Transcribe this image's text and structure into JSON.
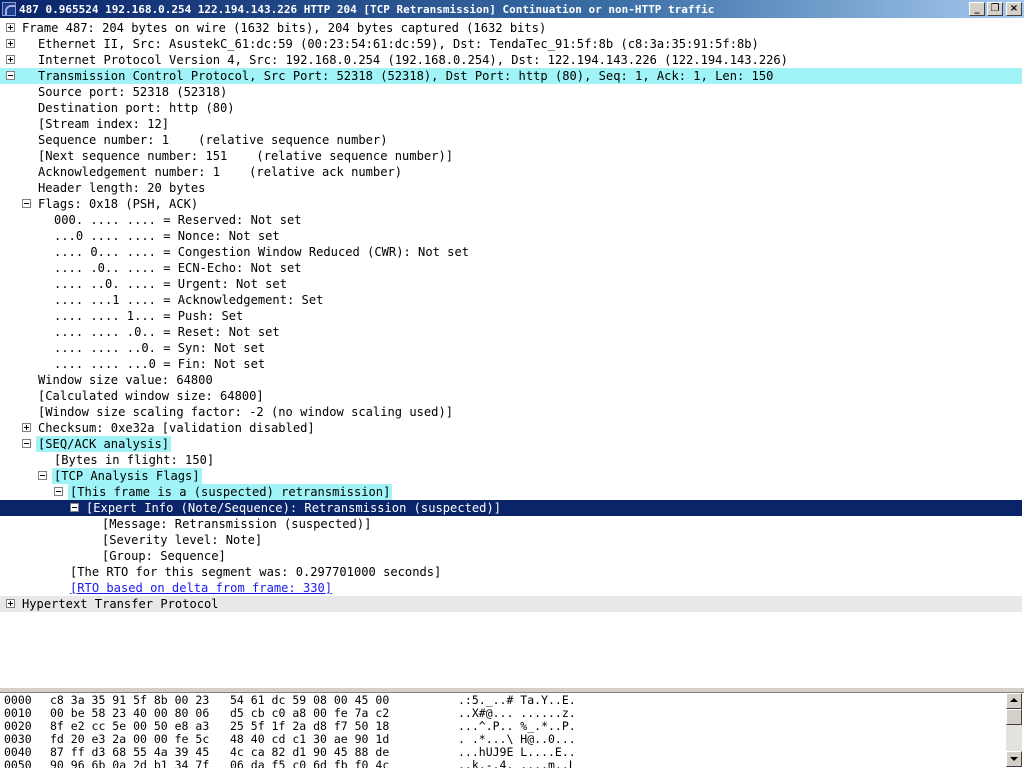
{
  "window": {
    "title": "487 0.965524 192.168.0.254 122.194.143.226 HTTP 204 [TCP Retransmission] Continuation or non-HTTP traffic",
    "minimize": "_",
    "restore": "❐",
    "close": "×"
  },
  "tree": [
    {
      "text": "Frame 487: 204 bytes on wire (1632 bits), 204 bytes captured (1632 bits)",
      "toggle": "plus"
    },
    {
      "text": "Ethernet II, Src: AsustekC_61:dc:59 (00:23:54:61:dc:59), Dst: TendaTec_91:5f:8b (c8:3a:35:91:5f:8b)",
      "toggle": "plus"
    },
    {
      "text": "Internet Protocol Version 4, Src: 192.168.0.254 (192.168.0.254), Dst: 122.194.143.226 (122.194.143.226)",
      "toggle": "plus"
    },
    {
      "text": "Transmission Control Protocol, Src Port: 52318 (52318), Dst Port: http (80), Seq: 1, Ack: 1, Len: 150",
      "toggle": "minus"
    },
    {
      "text": "Source port: 52318 (52318)"
    },
    {
      "text": "Destination port: http (80)"
    },
    {
      "text": "[Stream index: 12]"
    },
    {
      "text": "Sequence number: 1    (relative sequence number)"
    },
    {
      "text": "[Next sequence number: 151    (relative sequence number)]"
    },
    {
      "text": "Acknowledgement number: 1    (relative ack number)"
    },
    {
      "text": "Header length: 20 bytes"
    },
    {
      "text": "Flags: 0x18 (PSH, ACK)",
      "toggle": "minus"
    },
    {
      "text": "000. .... .... = Reserved: Not set"
    },
    {
      "text": "...0 .... .... = Nonce: Not set"
    },
    {
      "text": ".... 0... .... = Congestion Window Reduced (CWR): Not set"
    },
    {
      "text": ".... .0.. .... = ECN-Echo: Not set"
    },
    {
      "text": ".... ..0. .... = Urgent: Not set"
    },
    {
      "text": ".... ...1 .... = Acknowledgement: Set"
    },
    {
      "text": ".... .... 1... = Push: Set"
    },
    {
      "text": ".... .... .0.. = Reset: Not set"
    },
    {
      "text": ".... .... ..0. = Syn: Not set"
    },
    {
      "text": ".... .... ...0 = Fin: Not set"
    },
    {
      "text": "Window size value: 64800"
    },
    {
      "text": "[Calculated window size: 64800]"
    },
    {
      "text": "[Window size scaling factor: -2 (no window scaling used)]"
    },
    {
      "text": "Checksum: 0xe32a [validation disabled]",
      "toggle": "plus"
    },
    {
      "text": "[SEQ/ACK analysis]",
      "toggle": "minus"
    },
    {
      "text": "[Bytes in flight: 150]"
    },
    {
      "text": "[TCP Analysis Flags]",
      "toggle": "minus"
    },
    {
      "text": "[This frame is a (suspected) retransmission]",
      "toggle": "minus"
    },
    {
      "text": "[Expert Info (Note/Sequence): Retransmission (suspected)]",
      "toggle": "minus"
    },
    {
      "text": "[Message: Retransmission (suspected)]"
    },
    {
      "text": "[Severity level: Note]"
    },
    {
      "text": "[Group: Sequence]"
    },
    {
      "text": "[The RTO for this segment was: 0.297701000 seconds]"
    },
    {
      "text": "[RTO based on delta from frame: 330]"
    },
    {
      "text": "Hypertext Transfer Protocol",
      "toggle": "plus"
    }
  ],
  "hex": [
    {
      "offset": "0000",
      "bytes": "c8 3a 35 91 5f 8b 00 23   54 61 dc 59 08 00 45 00",
      "ascii": ".:5._..# Ta.Y..E."
    },
    {
      "offset": "0010",
      "bytes": "00 be 58 23 40 00 80 06   d5 cb c0 a8 00 fe 7a c2",
      "ascii": "..X#@... ......z."
    },
    {
      "offset": "0020",
      "bytes": "8f e2 cc 5e 00 50 e8 a3   25 5f 1f 2a d8 f7 50 18",
      "ascii": "...^.P.. %_.*..P."
    },
    {
      "offset": "0030",
      "bytes": "fd 20 e3 2a 00 00 fe 5c   48 40 cd c1 30 ae 90 1d",
      "ascii": ". .*...\\ H@..0..."
    },
    {
      "offset": "0040",
      "bytes": "87 ff d3 68 55 4a 39 45   4c ca 82 d1 90 45 88 de",
      "ascii": "...hUJ9E L....E.."
    },
    {
      "offset": "0050",
      "bytes": "90 96 6b 0a 2d b1 34 7f   06 da f5 c0 6d fb f0 4c",
      "ascii": "..k.-.4. ....m..L"
    }
  ]
}
